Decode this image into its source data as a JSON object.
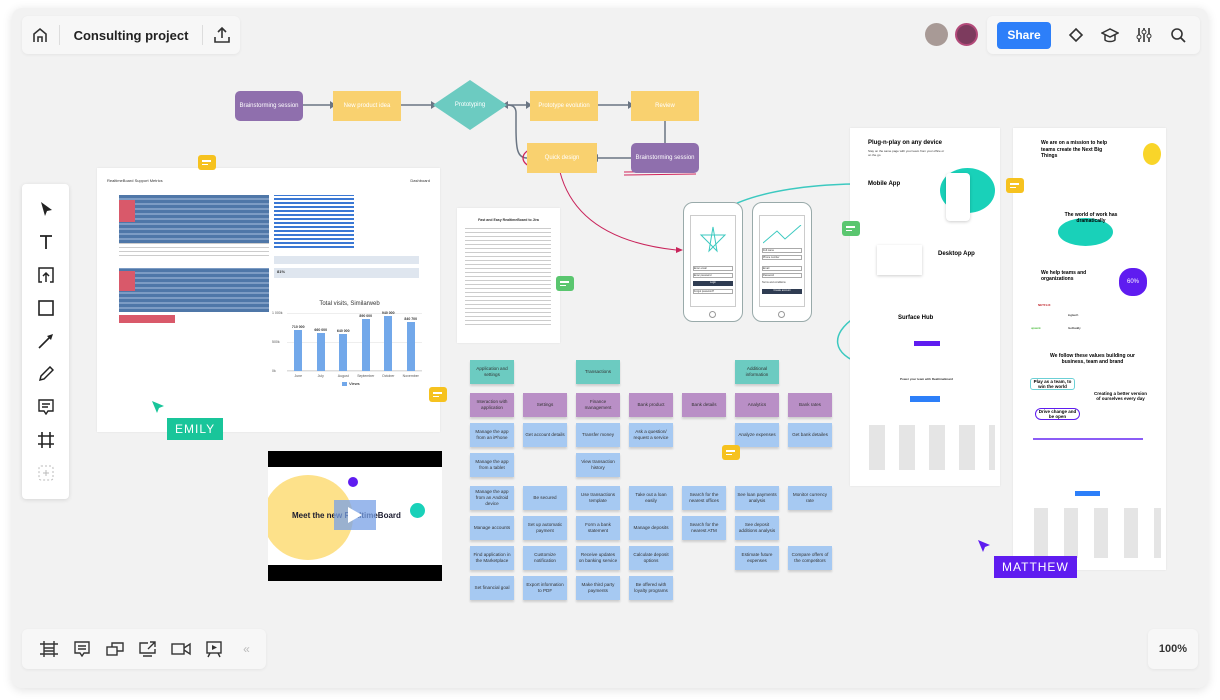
{
  "header": {
    "board_title": "Consulting project",
    "share_label": "Share",
    "icons": [
      "home-icon",
      "upload-icon",
      "bell-icon",
      "learning-cap-icon",
      "settings-sliders-icon",
      "search-icon"
    ]
  },
  "collaborators": [
    {
      "name": "avatar-1",
      "color": "#9b8f8f"
    },
    {
      "name": "avatar-2",
      "color": "#8a4a6a"
    }
  ],
  "left_toolbar": {
    "tools": [
      "select",
      "text",
      "upload",
      "shape",
      "arrow",
      "pen",
      "comment",
      "frame",
      "add-more"
    ]
  },
  "bottom_toolbar": {
    "tools": [
      "frames",
      "cards",
      "screens",
      "share-screen",
      "video-call",
      "presentation",
      "collapse"
    ],
    "collapse_label": "«"
  },
  "zoom_level": "100%",
  "flowchart": {
    "nodes": [
      {
        "id": "n1",
        "label": "Brainstorming session",
        "type": "purple"
      },
      {
        "id": "n2",
        "label": "New product idea",
        "type": "yellow"
      },
      {
        "id": "n3",
        "label": "Prototyping",
        "type": "diamond"
      },
      {
        "id": "n4",
        "label": "Prototype evolution",
        "type": "yellow"
      },
      {
        "id": "n5",
        "label": "Review",
        "type": "yellow"
      },
      {
        "id": "n6",
        "label": "Brainstorming session",
        "type": "purple"
      },
      {
        "id": "n7",
        "label": "Quick design",
        "type": "yellow"
      }
    ]
  },
  "dashboard": {
    "title": "RealtimeBoard Support Metrics",
    "right_label": "Dashboard",
    "kpi": "81%"
  },
  "chart_data": {
    "type": "bar",
    "title": "Total visits, Similarweb",
    "categories": [
      "June",
      "July",
      "August",
      "September",
      "October",
      "November"
    ],
    "values": [
      710000,
      660000,
      640000,
      890000,
      940000,
      840700
    ],
    "data_labels": [
      "710 000",
      "660 000",
      "640 000",
      "890 000",
      "940 000",
      "840 700"
    ],
    "y_ticks": [
      "0k",
      "500k",
      "1 000k"
    ],
    "ylim": [
      0,
      1000000
    ],
    "legend": [
      "Views"
    ],
    "legend_position": "bottom"
  },
  "document": {
    "title": "Fast and Easy RealtimeBoard to Jira"
  },
  "stickies": {
    "columns": [
      {
        "header": "Application and settings",
        "category": "Interaction with application",
        "items": [
          "Manage the app from an iPhone",
          "Manage the app from a tablet",
          "Manage the app from an Android device",
          "Manage accounts",
          "Find application in the Marketplace",
          "Set financial goal"
        ]
      },
      {
        "header": "",
        "category": "Settings",
        "items": [
          "Get account details",
          "",
          "Be secured",
          "Set up automatic payment",
          "Customize notification",
          "Export information to PDF"
        ]
      },
      {
        "header": "Transactions",
        "category": "Finance management",
        "items": [
          "Transfer money",
          "View transaction history",
          "Use transactions template",
          "Form a bank statement",
          "Receive updates on banking service",
          "Make third party payments"
        ]
      },
      {
        "header": "",
        "category": "Bank product",
        "items": [
          "Ask a question/ request a service",
          "",
          "Take out a loan easily",
          "Manage deposits",
          "Calculate deposit options",
          "Be offered with loyalty programs"
        ]
      },
      {
        "header": "",
        "category": "Bank details",
        "items": [
          "",
          "",
          "Search for the nearest offices",
          "Search for the nearest ATM",
          "",
          ""
        ]
      },
      {
        "header": "Additional information",
        "category": "Analytics",
        "items": [
          "Analyze expenses",
          "",
          "See loan payments analysis",
          "See deposit additions analysis",
          "Estimate future expenses",
          ""
        ]
      },
      {
        "header": "",
        "category": "Bank rates",
        "items": [
          "Get bank detailes",
          "",
          "Monitor currency rate",
          "",
          "Compare offers of the competitors",
          ""
        ]
      }
    ]
  },
  "video": {
    "title": "Meet the new RealtimeBoard"
  },
  "mockups": {
    "login": {
      "fields": [
        "Enter email",
        "Enter password"
      ],
      "button": "Login",
      "link": "Forgot password?"
    },
    "signup": {
      "fields": [
        "Full name",
        "Phone number",
        "Email",
        "Password"
      ],
      "checkbox": "Terms and conditions",
      "button": "Create account"
    }
  },
  "webpage_1": {
    "heading": "Plug-n-play on any device",
    "sub": "Stay on the same page with your team from your office or on the go",
    "mobile": "Mobile App",
    "desktop": "Desktop App",
    "surface": "Surface Hub",
    "power": "Power your team with RealtimeBoard"
  },
  "webpage_2": {
    "heading": "We are on a mission to help teams create the Next Big Things",
    "world": "The world of work has dramatically",
    "help": "We help teams and organizations",
    "stat": "60%",
    "values": "We follow these values building our business, team and brand",
    "v1": "Play as a team, to win the world",
    "v2": "Creating a better version of ourselves every day",
    "v3": "Drive change and be open",
    "logos": [
      "NETFLIX",
      "logitech",
      "GoDaddy",
      "upwork",
      "Autodesk"
    ]
  },
  "cursors": [
    {
      "name": "EMILY",
      "color": "#19c59a"
    },
    {
      "name": "MATTHEW",
      "color": "#5f1cf0"
    }
  ]
}
